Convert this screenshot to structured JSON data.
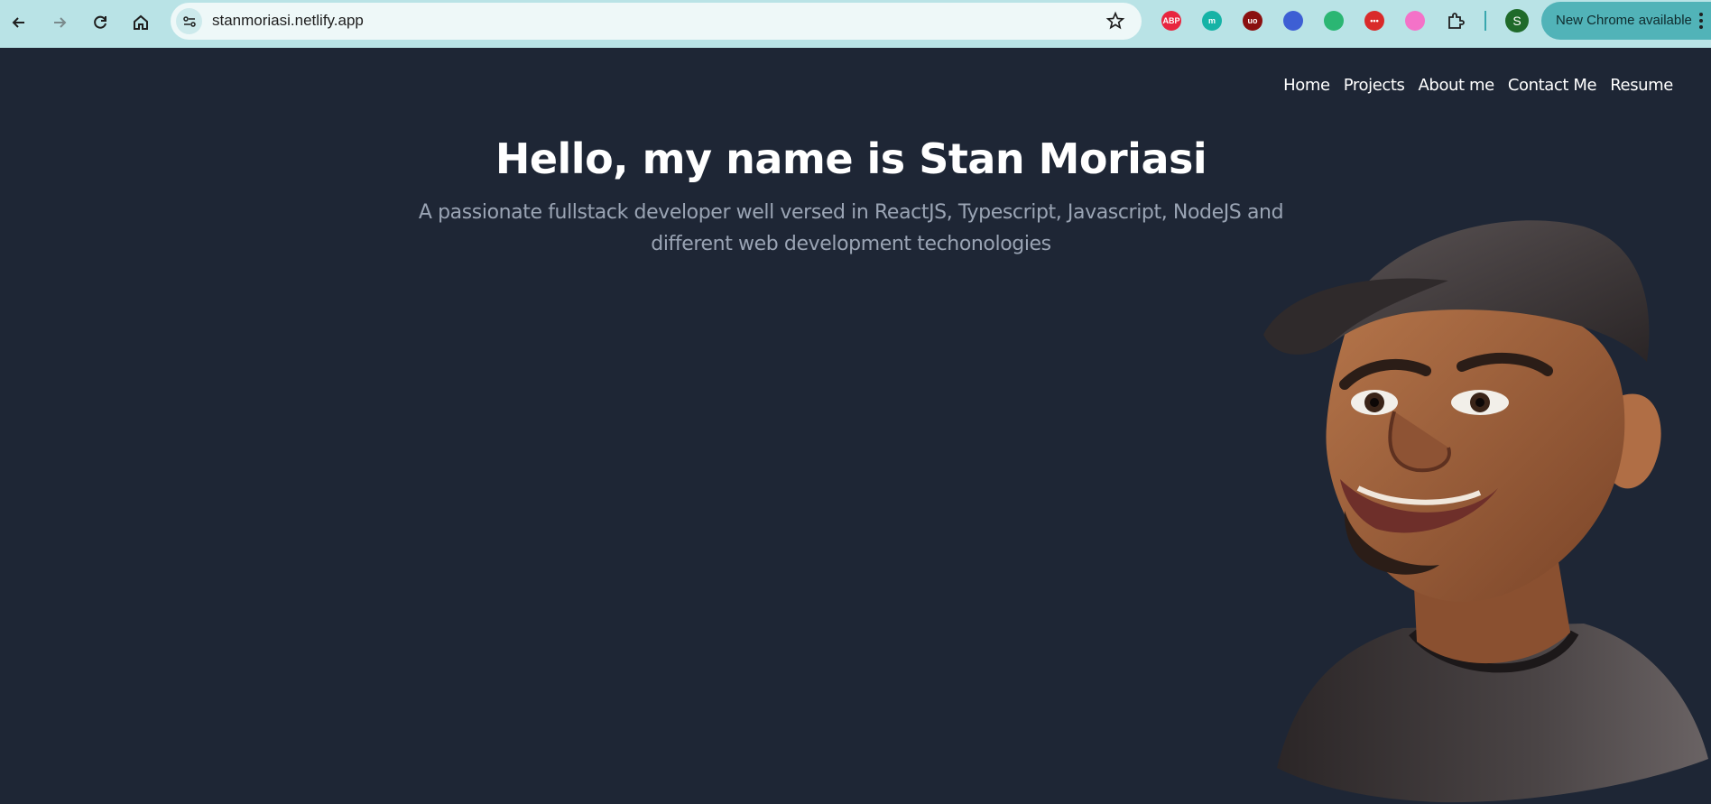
{
  "browser": {
    "url": "stanmoriasi.netlify.app",
    "update_label": "New Chrome available",
    "profile_initial": "S",
    "extensions": [
      {
        "name": "adblock-plus-icon",
        "label": "ABP",
        "color": "#e8263f"
      },
      {
        "name": "m-extension-icon",
        "label": "m",
        "color": "#16b3a6"
      },
      {
        "name": "ublock-origin-icon",
        "label": "uo",
        "color": "#8a1010"
      },
      {
        "name": "globe-extension-icon",
        "label": "",
        "color": "#3d5fd4"
      },
      {
        "name": "layers-extension-icon",
        "label": "",
        "color": "#2bb673"
      },
      {
        "name": "red-extension-icon",
        "label": "•••",
        "color": "#d92a2a"
      },
      {
        "name": "pink-extension-icon",
        "label": "",
        "color": "#f472c8"
      }
    ]
  },
  "nav": {
    "items": [
      "Home",
      "Projects",
      "About me",
      "Contact Me",
      "Resume"
    ]
  },
  "hero": {
    "title": "Hello, my name is Stan Moriasi",
    "subtitle": "A passionate fullstack developer well versed in ReactJS, Typescript, Javascript, NodeJS and different web development techonologies"
  },
  "colors": {
    "page_background": "#1e2635",
    "toolbar": "#b9e3e6",
    "title": "#ffffff",
    "subtitle": "#9aa4b4"
  }
}
